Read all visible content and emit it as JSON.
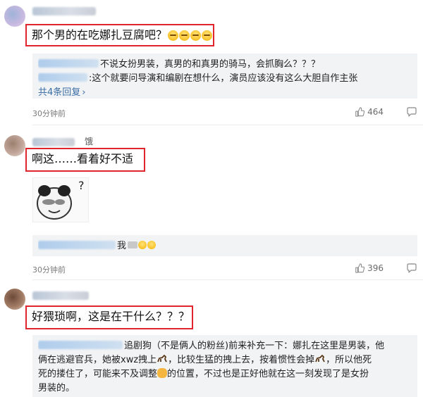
{
  "comments": [
    {
      "text": "那个男的在吃娜扎豆腐吧？",
      "emoji_icons": [
        "smirk-emoji-icon",
        "smirk-emoji-icon",
        "smirk-emoji-icon",
        "smirk-emoji-icon"
      ],
      "replies": [
        "不说女扮男装，真男的和真男的骑马，会抓胸么？？？",
        ":这个就要问导演和编剧在想什么，演员应该没有这么大胆自作主张"
      ],
      "more_replies": "共4条回复",
      "time": "30分钟前",
      "likes": "464"
    },
    {
      "name_fragment": "饿",
      "text": "啊这……看着好不适",
      "reply": "我",
      "time": "30分钟前",
      "likes": "396"
    },
    {
      "text": "好猥琐啊，这是在干什么？？？",
      "reply_lines": [
        "追剧狗（不是俩人的粉丝)前来补充一下：娜扎在这里是男装，他",
        "俩在逃避官兵，她被xwz拽上",
        "，比较生猛的拽上去，按着惯性会掉",
        "，所以他死",
        "死的搂住了，可能来不及调整",
        "的位置，不过也是正好他就在这一刻发现了是女扮",
        "男装的。"
      ]
    }
  ],
  "colors": {
    "highlight": "#e0252c",
    "link": "#3b6ea5",
    "reply_bg": "#f2f3f5",
    "meta": "#7a7a7a"
  }
}
